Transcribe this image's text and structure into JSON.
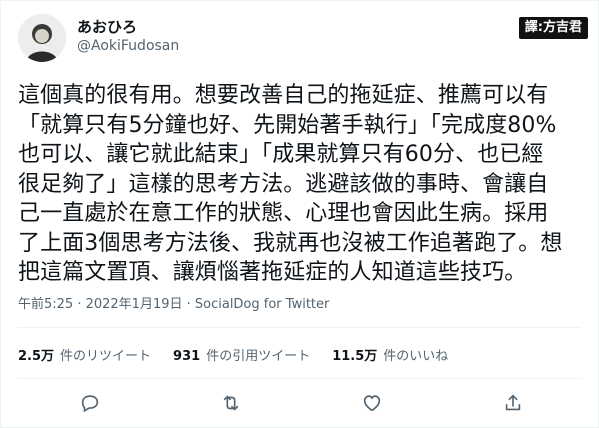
{
  "user": {
    "display_name": "あおひろ",
    "handle": "@AokiFudosan"
  },
  "badge": "譯:方吉君",
  "tweet": {
    "text": "這個真的很有用。想要改善自己的拖延症、推薦可以有\n「就算只有5分鐘也好、先開始著手執行」「完成度80%\n也可以、讓它就此結束」「成果就算只有60分、也已經\n很足夠了」這樣的思考方法。逃避該做的事時、會讓自\n己一直處於在意工作的狀態、心理也會因此生病。採用\n了上面3個思考方法後、我就再也沒被工作追著跑了。想\n把這篇文置頂、讓煩惱著拖延症的人知道這些技巧。"
  },
  "meta": "午前5:25 · 2022年1月19日 · SocialDog for Twitter",
  "stats": [
    {
      "count": "2.5万",
      "label": "件のリツイート"
    },
    {
      "count": "931",
      "label": "件の引用ツイート"
    },
    {
      "count": "11.5万",
      "label": "件のいいね"
    }
  ],
  "actions": [
    "reply-icon",
    "retweet-icon",
    "like-icon",
    "share-icon"
  ],
  "colors": {
    "text": "#0f1419",
    "secondary": "#536471",
    "border": "#eff3f4"
  }
}
